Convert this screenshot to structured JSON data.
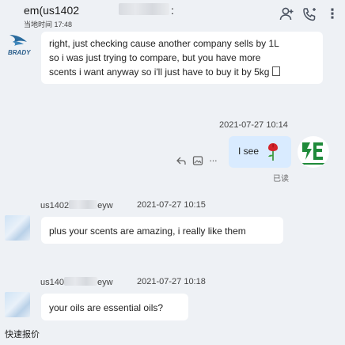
{
  "header": {
    "title": "em(us1402",
    "local_time_label": "当地时间",
    "local_time": "17:48",
    "icons": [
      "contact-icon",
      "call-icon",
      "more-icon"
    ]
  },
  "messages": [
    {
      "id": "m1",
      "direction": "incoming",
      "text_line1": "right, just checking cause another company sells by 1L",
      "text_line2": "so i was just trying to compare, but you have more",
      "text_line3": "scents i want anyway so i'll just have to buy it by 5kg",
      "avatar_text": "BRADY"
    },
    {
      "id": "m2",
      "direction": "outgoing",
      "timestamp": "2021-07-27 10:14",
      "text": "I see",
      "emoji": "rose",
      "status": "已读",
      "actions": [
        "reply-icon",
        "image-icon",
        "more-icon"
      ]
    },
    {
      "id": "m3",
      "direction": "incoming",
      "sender_prefix": "us1402",
      "sender_suffix": "eyw",
      "timestamp": "2021-07-27 10:15",
      "text": "plus your scents are amazing, i really like them"
    },
    {
      "id": "m4",
      "direction": "incoming",
      "sender_prefix": "us140",
      "sender_suffix": "eyw",
      "timestamp": "2021-07-27 10:18",
      "text": "your oils are essential oils?"
    }
  ],
  "footer": {
    "quick_quote": "快速报价"
  },
  "colors": {
    "background": "#eef1f5",
    "incoming_bubble": "#ffffff",
    "outgoing_bubble": "#d9ebff",
    "avatar_green": "#1f8a3a"
  }
}
